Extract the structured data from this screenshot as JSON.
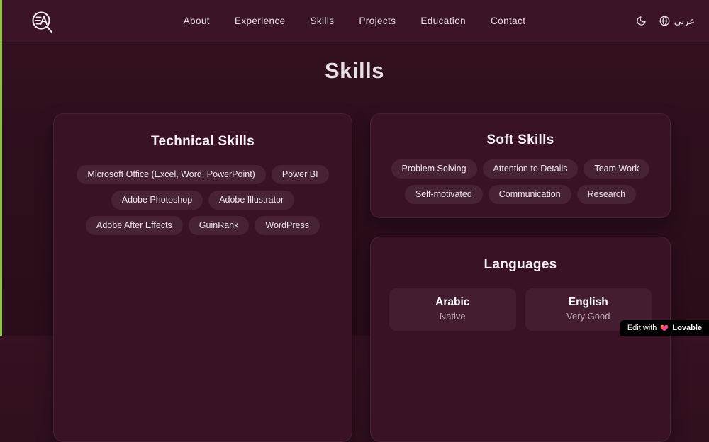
{
  "header": {
    "logo_name": "EA search logo",
    "nav": [
      "About",
      "Experience",
      "Skills",
      "Projects",
      "Education",
      "Contact"
    ],
    "controls": {
      "theme_icon": "moon-icon",
      "language_icon": "globe-icon",
      "language_label": "عربي"
    }
  },
  "page": {
    "title": "Skills"
  },
  "technical": {
    "title": "Technical Skills",
    "skills": [
      "Microsoft Office (Excel, Word, PowerPoint)",
      "Power BI",
      "Adobe Photoshop",
      "Adobe Illustrator",
      "Adobe After Effects",
      "GuinRank",
      "WordPress"
    ]
  },
  "soft": {
    "title": "Soft Skills",
    "skills": [
      "Problem Solving",
      "Attention to Details",
      "Team Work",
      "Self-motivated",
      "Communication",
      "Research"
    ]
  },
  "languages": {
    "title": "Languages",
    "items": [
      {
        "name": "Arabic",
        "level": "Native"
      },
      {
        "name": "English",
        "level": "Very Good"
      }
    ]
  },
  "badge": {
    "prefix": "Edit with",
    "brand": "Lovable"
  },
  "colors": {
    "header_bg": "#3b1527",
    "page_bg": "#2d0e1d",
    "card_bg": "#3a1225",
    "accent_edge": "#8cc63e",
    "text_light": "#f1e9ee",
    "text_muted": "#c4abb8"
  }
}
